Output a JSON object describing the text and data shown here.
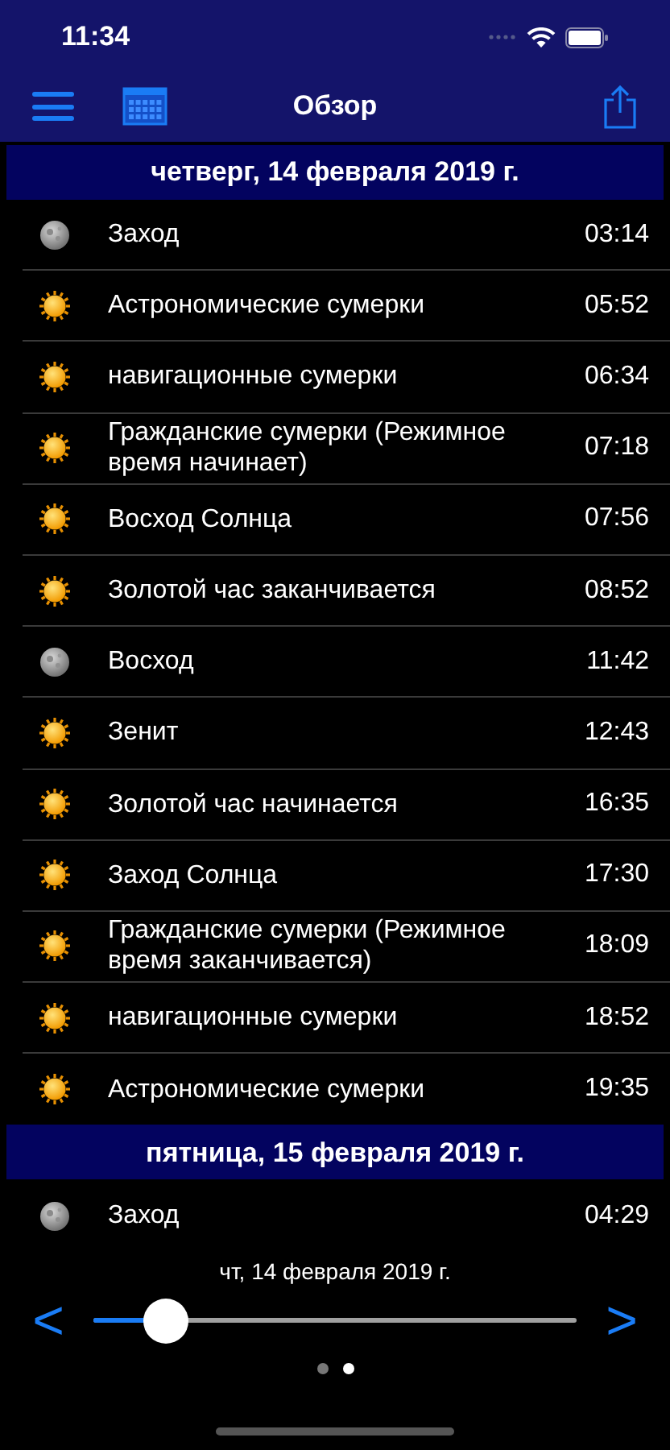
{
  "status_bar": {
    "time": "11:34"
  },
  "nav": {
    "title": "Обзор"
  },
  "sections": [
    {
      "header": "четверг, 14 февраля 2019 г.",
      "events": [
        {
          "kind": "moon",
          "label": "Заход",
          "time": "03:14"
        },
        {
          "kind": "sun",
          "label": "Астрономические сумерки",
          "time": "05:52"
        },
        {
          "kind": "sun",
          "label": "навигационные сумерки",
          "time": "06:34"
        },
        {
          "kind": "sun",
          "label": "Гражданские сумерки (Режимное время начинает)",
          "time": "07:18"
        },
        {
          "kind": "sun",
          "label": "Восход Солнца",
          "time": "07:56"
        },
        {
          "kind": "sun",
          "label": "Золотой час заканчивается",
          "time": "08:52"
        },
        {
          "kind": "moon",
          "label": "Восход",
          "time": "11:42"
        },
        {
          "kind": "sun",
          "label": "Зенит",
          "time": "12:43"
        },
        {
          "kind": "sun",
          "label": "Золотой час начинается",
          "time": "16:35"
        },
        {
          "kind": "sun",
          "label": "Заход Солнца",
          "time": "17:30"
        },
        {
          "kind": "sun",
          "label": "Гражданские сумерки (Режимное время заканчивается)",
          "time": "18:09"
        },
        {
          "kind": "sun",
          "label": "навигационные сумерки",
          "time": "18:52"
        },
        {
          "kind": "sun",
          "label": "Астрономические сумерки",
          "time": "19:35"
        }
      ]
    },
    {
      "header": "пятница, 15 февраля 2019 г.",
      "events": [
        {
          "kind": "moon",
          "label": "Заход",
          "time": "04:29"
        }
      ]
    }
  ],
  "date_slider": {
    "label": "чт, 14 февраля 2019 г.",
    "prev": "<",
    "next": ">",
    "level": 0.15
  },
  "pages": [
    {
      "selected": false
    },
    {
      "selected": true
    }
  ]
}
